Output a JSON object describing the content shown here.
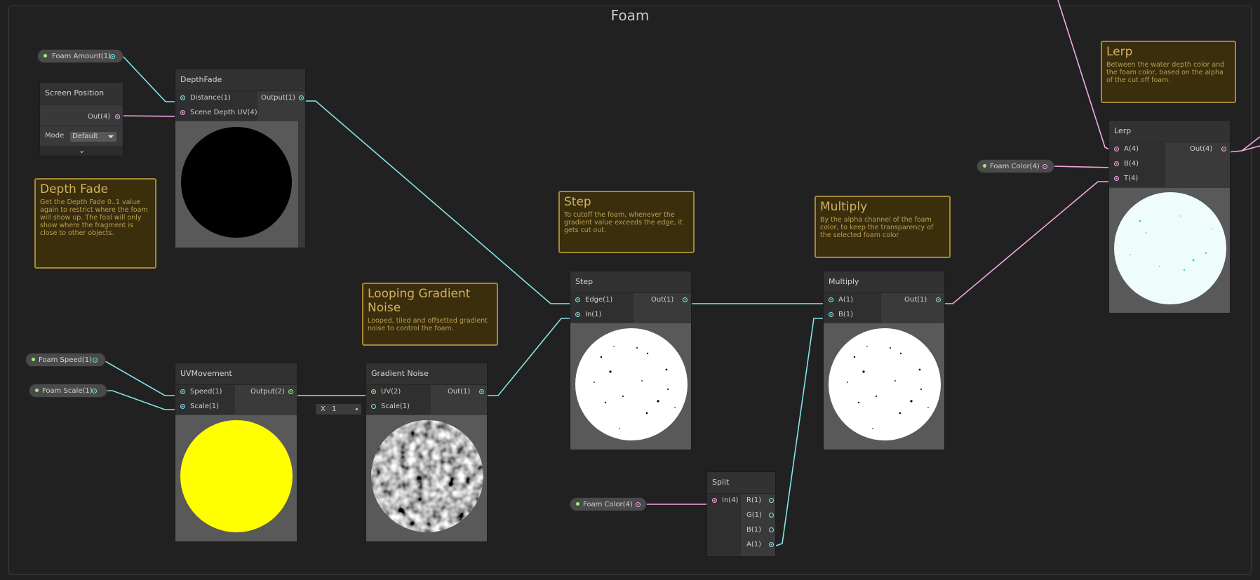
{
  "group": {
    "title": "Foam"
  },
  "properties": {
    "foam_amount": "Foam Amount(1)",
    "foam_speed": "Foam Speed(1)",
    "foam_scale": "Foam Scale(1)",
    "foam_color_a": "Foam Color(4)",
    "foam_color_b": "Foam Color(4)"
  },
  "nodes": {
    "screen_position": {
      "title": "Screen Position",
      "out": "Out(4)",
      "mode_label": "Mode",
      "mode_value": "Default"
    },
    "depth_fade": {
      "title": "DepthFade",
      "in1": "Distance(1)",
      "in2": "Scene Depth UV(4)",
      "out": "Output(1)"
    },
    "uv_movement": {
      "title": "UVMovement",
      "in1": "Speed(1)",
      "in2": "Scale(1)",
      "out": "Output(2)"
    },
    "gradient_noise": {
      "title": "Gradient Noise",
      "in1": "UV(2)",
      "in2": "Scale(1)",
      "out": "Out(1)",
      "scale_axis": "X",
      "scale_value": "1"
    },
    "step": {
      "title": "Step",
      "in1": "Edge(1)",
      "in2": "In(1)",
      "out": "Out(1)"
    },
    "multiply": {
      "title": "Multiply",
      "in1": "A(1)",
      "in2": "B(1)",
      "out": "Out(1)"
    },
    "split": {
      "title": "Split",
      "in": "In(4)",
      "outs": [
        "R(1)",
        "G(1)",
        "B(1)",
        "A(1)"
      ]
    },
    "lerp": {
      "title": "Lerp",
      "in1": "A(4)",
      "in2": "B(4)",
      "in3": "T(4)",
      "out": "Out(4)"
    }
  },
  "notes": {
    "lerp": {
      "title": "Lerp",
      "body": "Between the water depth color and the foam color, based on the alpha of the cut off foam."
    },
    "depth_fade": {
      "title": "Depth Fade",
      "body": "Get the Depth Fade 0..1 value again to restrict where the foam will show up. The foal will only show where the fragment is close to other objects."
    },
    "step": {
      "title": "Step",
      "body": "To cutoff the foam, whenever the gradient value exceeds the edge, it gets cut out."
    },
    "multiply": {
      "title": "Multiply",
      "body": "By the alpha channel of the foam color, to keep the transparency of the selected foam color"
    },
    "looping_noise": {
      "title": "Looping Gradient Noise",
      "body": "Looped, tiled and offsetted gradient noise to control the foam."
    }
  },
  "colors": {
    "wire_float": "#84e4e7",
    "wire_vector4": "#f4a8e6",
    "wire_vector2": "#9ef070",
    "sticky_bg": "#3a2e0d",
    "sticky_border": "#a48836",
    "canvas": "#202020"
  }
}
